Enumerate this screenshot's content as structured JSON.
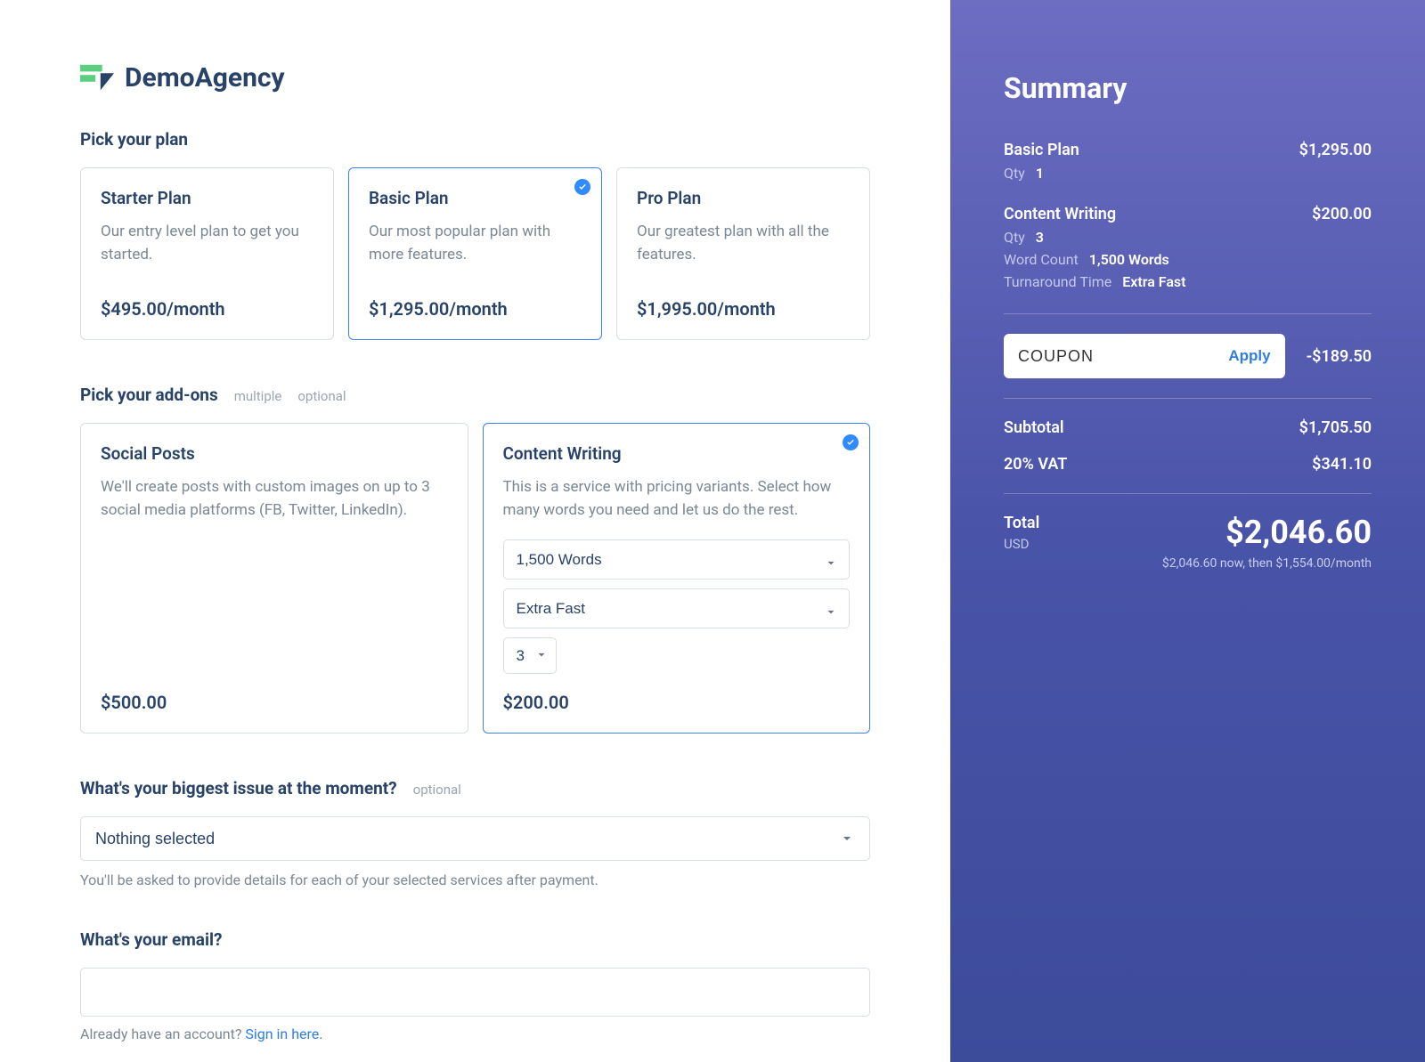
{
  "brand": {
    "name": "DemoAgency"
  },
  "sections": {
    "plans_label": "Pick your plan",
    "addons_label": "Pick your add-ons",
    "addons_tag_multiple": "multiple",
    "addons_tag_optional": "optional",
    "issue_label": "What's your biggest issue at the moment?",
    "issue_tag_optional": "optional",
    "issue_placeholder": "Nothing selected",
    "issue_helper": "You'll be asked to provide details for each of your selected services after payment.",
    "email_label": "What's your email?",
    "signin_prefix": "Already have an account? ",
    "signin_link": "Sign in here."
  },
  "plans": [
    {
      "title": "Starter Plan",
      "desc": "Our entry level plan to get you started.",
      "price": "$495.00/month",
      "selected": false
    },
    {
      "title": "Basic Plan",
      "desc": "Our most popular plan with more features.",
      "price": "$1,295.00/month",
      "selected": true
    },
    {
      "title": "Pro Plan",
      "desc": "Our greatest plan with all the features.",
      "price": "$1,995.00/month",
      "selected": false
    }
  ],
  "addons": [
    {
      "title": "Social Posts",
      "desc": "We'll create posts with custom images on up to 3 social media platforms (FB, Twitter, LinkedIn).",
      "price": "$500.00",
      "selected": false
    },
    {
      "title": "Content Writing",
      "desc": "This is a service with pricing variants. Select how many words you need and let us do the rest.",
      "price": "$200.00",
      "selected": true,
      "word_count": "1,500 Words",
      "turnaround": "Extra Fast",
      "qty": "3"
    }
  ],
  "summary": {
    "title": "Summary",
    "items": [
      {
        "name": "Basic Plan",
        "price": "$1,295.00",
        "lines": [
          {
            "label": "Qty",
            "value": "1"
          }
        ]
      },
      {
        "name": "Content Writing",
        "price": "$200.00",
        "lines": [
          {
            "label": "Qty",
            "value": "3"
          },
          {
            "label": "Word Count",
            "value": "1,500 Words"
          },
          {
            "label": "Turnaround Time",
            "value": "Extra Fast"
          }
        ]
      }
    ],
    "coupon_value": "COUPON",
    "apply_label": "Apply",
    "coupon_discount": "-$189.50",
    "subtotal_label": "Subtotal",
    "subtotal_value": "$1,705.50",
    "vat_label": "20% VAT",
    "vat_value": "$341.10",
    "total_label": "Total",
    "currency": "USD",
    "total_value": "$2,046.60",
    "total_note": "$2,046.60 now, then $1,554.00/month"
  }
}
